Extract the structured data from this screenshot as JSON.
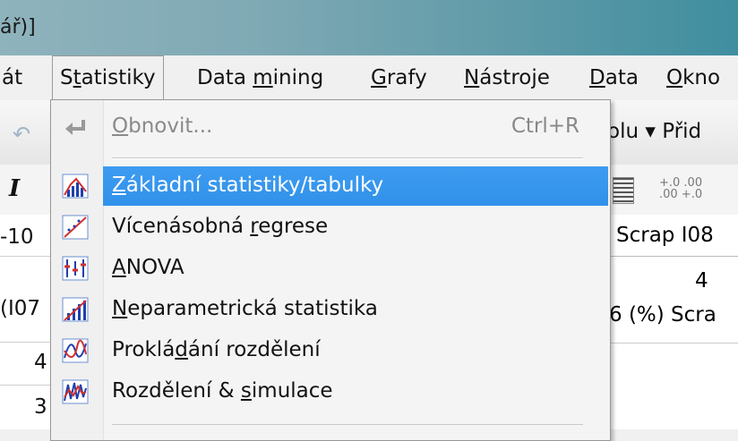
{
  "window": {
    "title_fragment": "ář)]"
  },
  "menubar": {
    "items": [
      {
        "label": "át",
        "ul": ""
      },
      {
        "pre": "S",
        "ul": "t",
        "post": "atistiky"
      },
      {
        "pre": "Data ",
        "ul": "m",
        "post": "ining"
      },
      {
        "pre": "",
        "ul": "G",
        "post": "rafy"
      },
      {
        "pre": "",
        "ul": "N",
        "post": "ástroje"
      },
      {
        "pre": "",
        "ul": "D",
        "post": "ata"
      },
      {
        "pre": "",
        "ul": "O",
        "post": "kno"
      }
    ]
  },
  "toolbar": {
    "right_text": "olu ▾  Přid"
  },
  "sheet": {
    "col_header": "Scrap I08",
    "col_number": "4",
    "col_sub": "6 (%) Scra",
    "left_cells": [
      "-10",
      "(I07",
      "4",
      "3"
    ]
  },
  "dropdown": {
    "items": [
      {
        "pre": "",
        "ul": "O",
        "post": "bnovit...",
        "shortcut": "Ctrl+R",
        "icon": "undo-arrow-icon",
        "disabled": true
      },
      {
        "pre": "",
        "ul": "Z",
        "post": "ákladní statistiky/tabulky",
        "icon": "basic-stats-icon",
        "highlight": true
      },
      {
        "pre": "Vícenásobná ",
        "ul": "r",
        "post": "egrese",
        "icon": "regression-icon"
      },
      {
        "pre": "",
        "ul": "A",
        "post": "NOVA",
        "icon": "anova-icon"
      },
      {
        "pre": "",
        "ul": "N",
        "post": "eparametrická statistika",
        "icon": "nonparametric-icon"
      },
      {
        "pre": "Proklá",
        "ul": "d",
        "post": "ání rozdělení",
        "icon": "distribution-fitting-icon"
      },
      {
        "pre": "Rozdělení & ",
        "ul": "s",
        "post": "imulace",
        "icon": "simulation-icon"
      }
    ]
  },
  "colors": {
    "highlight": "#3399ff",
    "menu_bg": "#f4f4f4"
  }
}
